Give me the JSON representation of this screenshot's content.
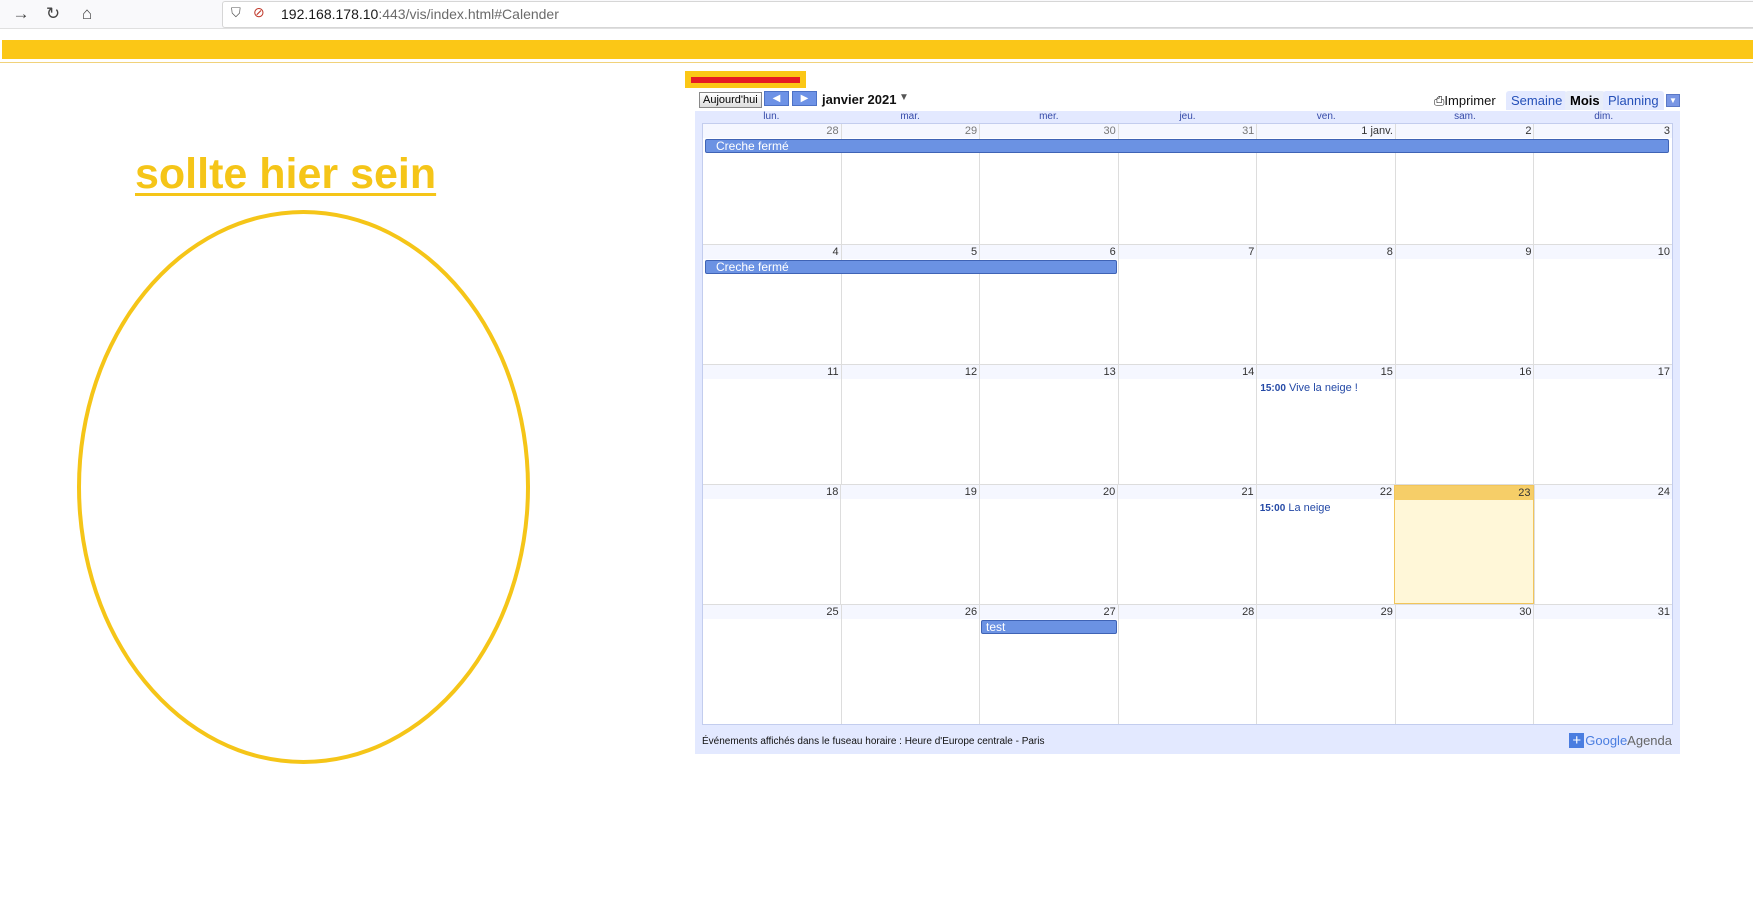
{
  "browser": {
    "url_host": "192.168.178.10",
    "url_rest": ":443/vis/index.html#Calender"
  },
  "left_panel": {
    "link_text": "sollte hier sein"
  },
  "calendar": {
    "today_button": "Aujourd'hui",
    "month_label": "janvier 2021",
    "print_label": "Imprimer",
    "tabs": [
      "Semaine",
      "Mois",
      "Planning"
    ],
    "active_tab": "Mois",
    "day_headers": [
      "lun.",
      "mar.",
      "mer.",
      "jeu.",
      "ven.",
      "sam.",
      "dim."
    ],
    "weeks": [
      [
        "28",
        "29",
        "30",
        "31",
        "1 janv.",
        "2",
        "3"
      ],
      [
        "4",
        "5",
        "6",
        "7",
        "8",
        "9",
        "10"
      ],
      [
        "11",
        "12",
        "13",
        "14",
        "15",
        "16",
        "17"
      ],
      [
        "18",
        "19",
        "20",
        "21",
        "22",
        "23",
        "24"
      ],
      [
        "25",
        "26",
        "27",
        "28",
        "29",
        "30",
        "31"
      ]
    ],
    "events": {
      "creche_week1": "Creche fermé",
      "creche_week2": "Creche fermé",
      "test": "test",
      "neige1_time": "15:00",
      "neige1_title": "Vive la neige !",
      "neige2_time": "15:00",
      "neige2_title": "La neige"
    },
    "timezone_note": "Événements affichés dans le fuseau horaire : Heure d'Europe centrale - Paris",
    "brand_google": "Google",
    "brand_agenda": "Agenda",
    "today_date": "23"
  }
}
